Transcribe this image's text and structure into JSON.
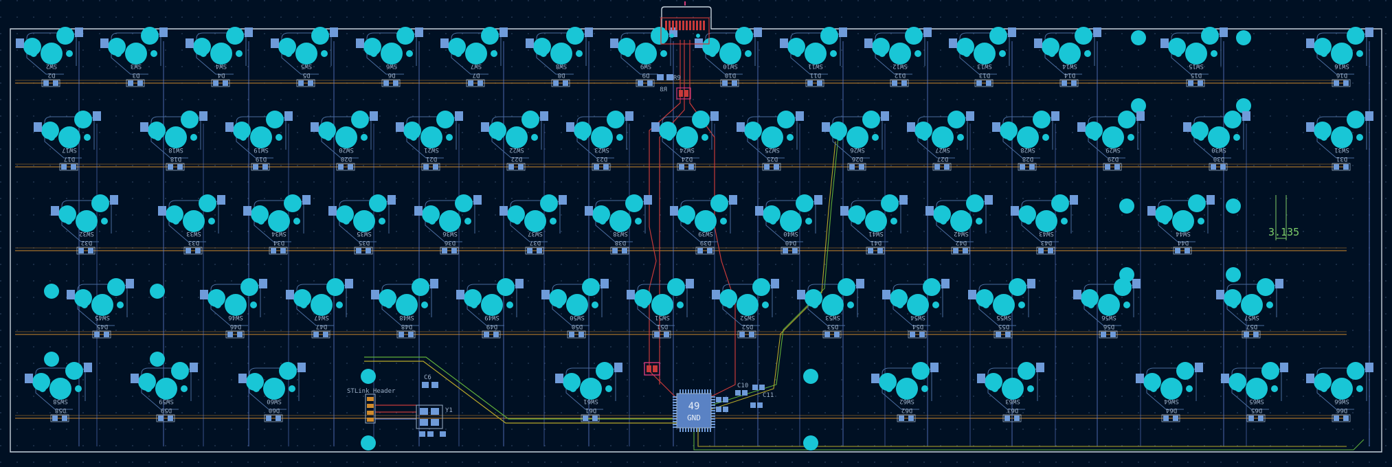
{
  "colors": {
    "background": "#001023",
    "grid_dot": "#2a3f5c",
    "board_outline": "#c8d2dc",
    "pad_copper": "#19c6d6",
    "smd_pad": "#6f9bd9",
    "silk_text": "#9db0c8",
    "silk_outline": "#4a6c9e",
    "trace_orange": "#d08a2c",
    "trace_blue": "#5f7dd1",
    "trace_red": "#c83a3a",
    "trace_green": "#5fae3a",
    "trace_yellow": "#b8a82a",
    "dimension": "#7fcf6a",
    "highlight_pink": "#d63a7a"
  },
  "dimension_label": "3.135",
  "mcu": {
    "pin_count": "49",
    "net": "GND"
  },
  "stlink_header_label": "STLink Header",
  "small_component_labels": [
    "R8",
    "R9",
    "C6",
    "C10",
    "C11",
    "Y1"
  ],
  "keys": [
    {
      "sw": "SW2",
      "d": "D2"
    },
    {
      "sw": "SW3",
      "d": "D3"
    },
    {
      "sw": "SW4",
      "d": "D4"
    },
    {
      "sw": "SW5",
      "d": "D5"
    },
    {
      "sw": "SW6",
      "d": "D6"
    },
    {
      "sw": "SW7",
      "d": "D7"
    },
    {
      "sw": "SW8",
      "d": "D8"
    },
    {
      "sw": "SW9",
      "d": "D9"
    },
    {
      "sw": "SW10",
      "d": "D10"
    },
    {
      "sw": "SW11",
      "d": "D11"
    },
    {
      "sw": "SW12",
      "d": "D12"
    },
    {
      "sw": "SW13",
      "d": "D13"
    },
    {
      "sw": "SW14",
      "d": "D14"
    },
    {
      "sw": "SW15",
      "d": "D15"
    },
    {
      "sw": "SW16",
      "d": "D16"
    },
    {
      "sw": "SW17",
      "d": "D17"
    },
    {
      "sw": "SW18",
      "d": "D18"
    },
    {
      "sw": "SW19",
      "d": "D19"
    },
    {
      "sw": "SW20",
      "d": "D20"
    },
    {
      "sw": "SW21",
      "d": "D21"
    },
    {
      "sw": "SW22",
      "d": "D22"
    },
    {
      "sw": "SW23",
      "d": "D23"
    },
    {
      "sw": "SW24",
      "d": "D24"
    },
    {
      "sw": "SW25",
      "d": "D25"
    },
    {
      "sw": "SW26",
      "d": "D26"
    },
    {
      "sw": "SW27",
      "d": "D27"
    },
    {
      "sw": "SW28",
      "d": "D28"
    },
    {
      "sw": "SW29",
      "d": "D29"
    },
    {
      "sw": "SW30",
      "d": "D30"
    },
    {
      "sw": "SW31",
      "d": "D31"
    },
    {
      "sw": "SW32",
      "d": "D32"
    },
    {
      "sw": "SW33",
      "d": "D33"
    },
    {
      "sw": "SW34",
      "d": "D34"
    },
    {
      "sw": "SW35",
      "d": "D35"
    },
    {
      "sw": "SW36",
      "d": "D36"
    },
    {
      "sw": "SW37",
      "d": "D37"
    },
    {
      "sw": "SW38",
      "d": "D38"
    },
    {
      "sw": "SW39",
      "d": "D39"
    },
    {
      "sw": "SW40",
      "d": "D40"
    },
    {
      "sw": "SW41",
      "d": "D41"
    },
    {
      "sw": "SW42",
      "d": "D42"
    },
    {
      "sw": "SW43",
      "d": "D43"
    },
    {
      "sw": "SW44",
      "d": "D44"
    },
    {
      "sw": "SW45",
      "d": "D45"
    },
    {
      "sw": "SW46",
      "d": "D46"
    },
    {
      "sw": "SW47",
      "d": "D47"
    },
    {
      "sw": "SW48",
      "d": "D48"
    },
    {
      "sw": "SW49",
      "d": "D49"
    },
    {
      "sw": "SW50",
      "d": "D50"
    },
    {
      "sw": "SW51",
      "d": "D51"
    },
    {
      "sw": "SW52",
      "d": "D52"
    },
    {
      "sw": "SW53",
      "d": "D53"
    },
    {
      "sw": "SW54",
      "d": "D54"
    },
    {
      "sw": "SW55",
      "d": "D55"
    },
    {
      "sw": "SW56",
      "d": "D56"
    },
    {
      "sw": "SW57",
      "d": "D57"
    },
    {
      "sw": "SW58",
      "d": "D58"
    },
    {
      "sw": "SW59",
      "d": "D59"
    },
    {
      "sw": "SW60",
      "d": "D60"
    },
    {
      "sw": "SW61",
      "d": "D61"
    },
    {
      "sw": "SW62",
      "d": "D62"
    },
    {
      "sw": "SW63",
      "d": "D63"
    },
    {
      "sw": "SW64",
      "d": "D64"
    },
    {
      "sw": "SW65",
      "d": "D65"
    },
    {
      "sw": "SW66",
      "d": "D66"
    }
  ]
}
